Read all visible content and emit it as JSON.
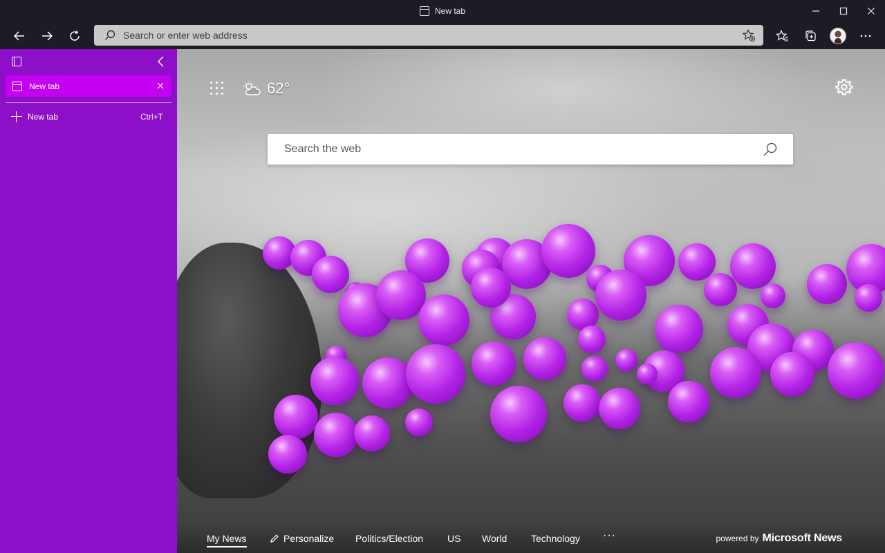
{
  "window": {
    "title": "New tab"
  },
  "toolbar": {
    "address_placeholder": "Search or enter web address"
  },
  "sidebar": {
    "active_tab_label": "New tab",
    "new_tab_label": "New tab",
    "new_tab_shortcut": "Ctrl+T"
  },
  "newtab_page": {
    "weather_temp": "62°",
    "search_placeholder": "Search the web",
    "news_tabs": [
      {
        "label": "My News",
        "active": true
      },
      {
        "label": "Personalize",
        "active": false
      },
      {
        "label": "Politics/Election",
        "active": false
      },
      {
        "label": "US",
        "active": false
      },
      {
        "label": "World",
        "active": false
      },
      {
        "label": "Technology",
        "active": false
      }
    ],
    "more_label": "···",
    "powered_by_prefix": "powered by",
    "powered_by_brand": "Microsoft News"
  },
  "colors": {
    "sidebar_bg": "#8d10c8",
    "sidebar_active_tab": "#c300f2",
    "titlebar_bg": "#1f1b24",
    "address_bar_bg": "#c9c9c9"
  },
  "icons": {
    "titlebar": [
      "tab-icon"
    ],
    "window_controls": [
      "minimize-icon",
      "maximize-icon",
      "close-icon"
    ],
    "toolbar": [
      "back-arrow-icon",
      "forward-arrow-icon",
      "refresh-icon",
      "search-icon",
      "add-favorite-icon",
      "favorites-icon",
      "collections-icon",
      "profile-avatar",
      "more-icon"
    ],
    "sidebar": [
      "vertical-tabs-icon",
      "chevron-left-icon",
      "tab-icon",
      "close-icon",
      "plus-icon"
    ],
    "newtab_page": [
      "app-launcher-icon",
      "weather-cloud-sun-icon",
      "settings-gear-icon",
      "search-icon",
      "pencil-icon"
    ]
  }
}
